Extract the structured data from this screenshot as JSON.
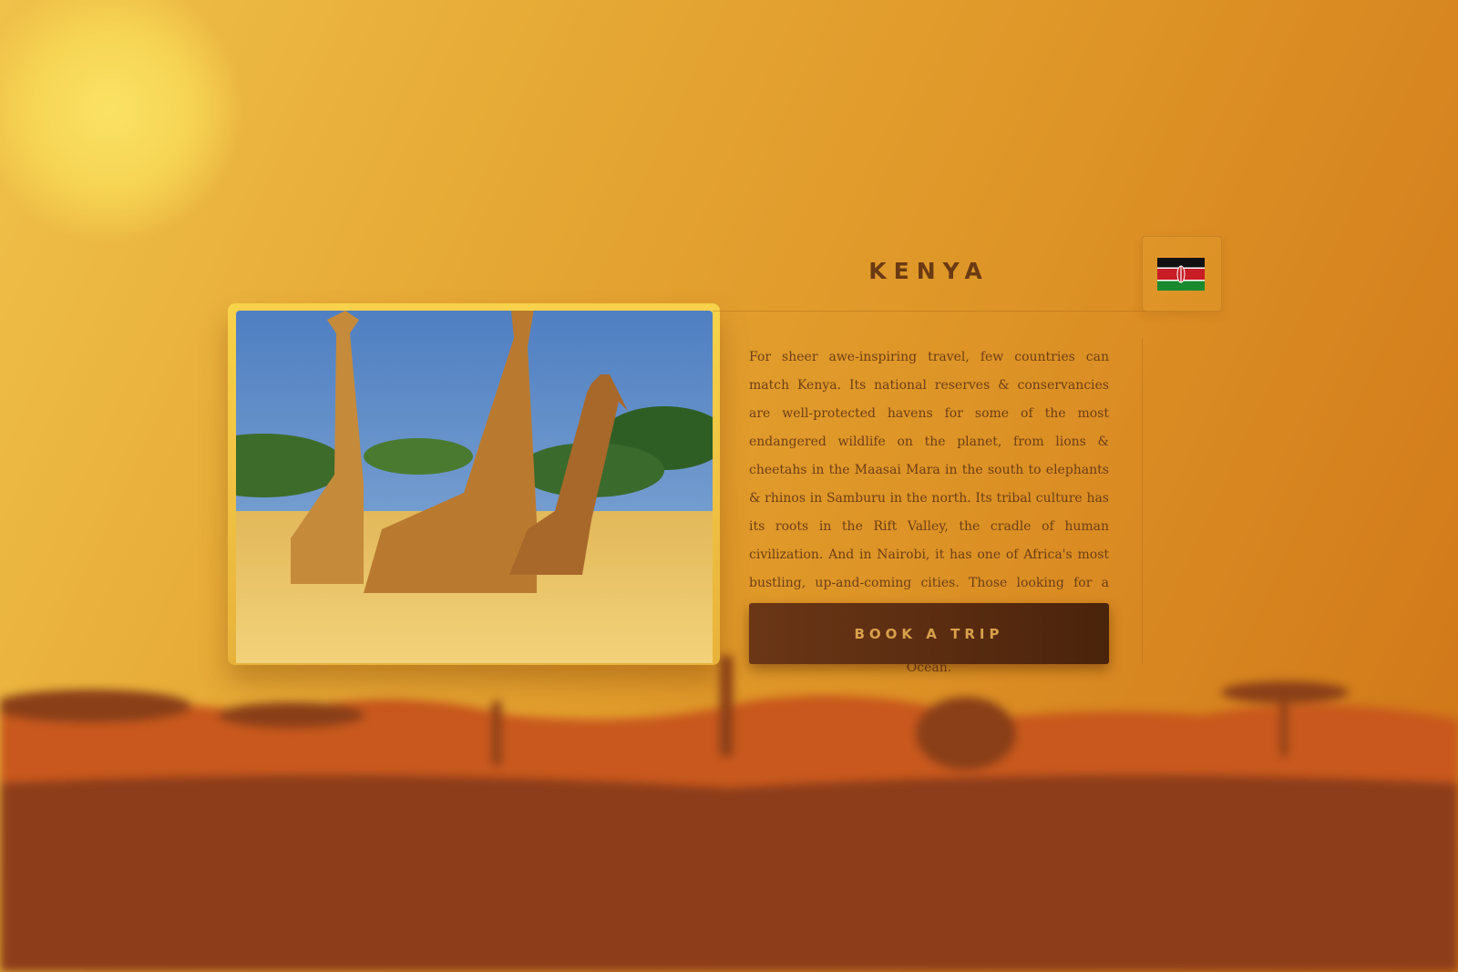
{
  "country": {
    "name": "KENYA",
    "description": "For sheer awe-inspiring travel, few countries can match Kenya. Its national reserves & conservancies are well-protected havens for some of the most endangered wildlife on the planet, from lions & cheetahs in the Maasai Mara in the south to elephants & rhinos in Samburu in the north. Its tribal culture has its roots in the Rift Valley, the cradle of human civilization. And in Nairobi, it has one of Africa's most bustling, up-and-coming cities. Those looking for a more laid-back trip will find azure waters & white sands near Mombasa, where Kenya meets the Indian Ocean.",
    "flag_icon": "kenya-flag-icon",
    "photo_subject": "giraffes-on-savanna"
  },
  "actions": {
    "book_label": "BOOK A TRIP"
  },
  "colors": {
    "sky_gold": "#e6a935",
    "title_brown": "#6a3a12",
    "button_brown": "#5a2c10",
    "button_text": "#d9a04b"
  }
}
